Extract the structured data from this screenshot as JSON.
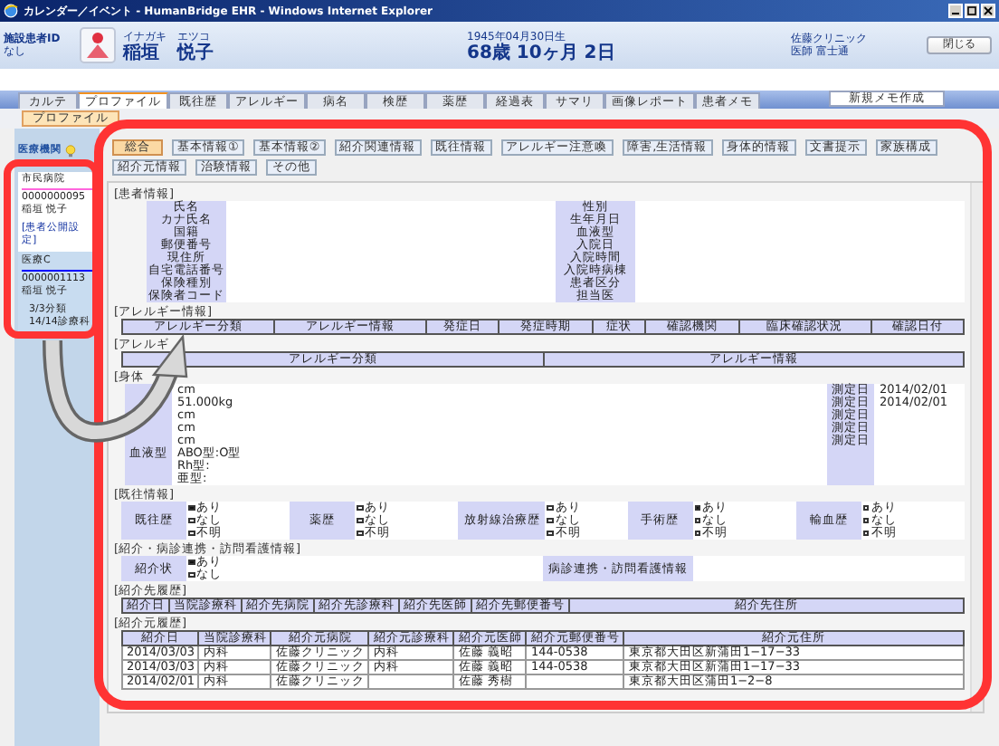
{
  "window": {
    "title": "カレンダー／イベント - HumanBridge EHR - Windows Internet Explorer"
  },
  "patient": {
    "id_label": "施設患者ID",
    "id_value": "なし",
    "kana": "イナガキ　エツコ",
    "name": "稲垣　悦子",
    "birth": "1945年04月30日生",
    "age": "68歳 10ヶ月 2日",
    "facility": "佐藤クリニック",
    "doctor": "医師 富士通",
    "close_button": "閉じる"
  },
  "tabs": [
    {
      "label": "カルテ",
      "selected": false
    },
    {
      "label": "プロファイル",
      "selected": true
    },
    {
      "label": "既往歴",
      "selected": false
    },
    {
      "label": "アレルギー",
      "selected": false
    },
    {
      "label": "病名",
      "selected": false
    },
    {
      "label": "検歴",
      "selected": false
    },
    {
      "label": "薬歴",
      "selected": false
    },
    {
      "label": "経過表",
      "selected": false
    },
    {
      "label": "サマリ",
      "selected": false
    },
    {
      "label": "画像レポート",
      "selected": false
    },
    {
      "label": "患者メモ",
      "selected": false
    }
  ],
  "new_memo_button": "新規メモ作成",
  "subtabs": [
    {
      "label": "プロファイル",
      "selected": true
    }
  ],
  "sidebar": {
    "title": "医療機関",
    "institutions": [
      {
        "name": "市民病院",
        "color": "#ff66dd",
        "id": "0000000095",
        "patient": "稲垣 悦子",
        "link": "[患者公開設定]"
      },
      {
        "name": "医療C",
        "color": "#0000ff",
        "id": "0000001113",
        "patient": "稲垣 悦子",
        "notes": [
          "3/3分類",
          "14/14診療科"
        ]
      }
    ]
  },
  "filters": [
    {
      "label": "総合",
      "selected": true
    },
    {
      "label": "基本情報①",
      "selected": false
    },
    {
      "label": "基本情報②",
      "selected": false
    },
    {
      "label": "紹介関連情報",
      "selected": false
    },
    {
      "label": "既往情報",
      "selected": false
    },
    {
      "label": "アレルギー注意喚",
      "selected": false
    },
    {
      "label": "障害,生活情報",
      "selected": false
    },
    {
      "label": "身体的情報",
      "selected": false
    },
    {
      "label": "文書提示",
      "selected": false
    },
    {
      "label": "家族構成",
      "selected": false
    },
    {
      "label": "紹介元情報",
      "selected": false
    },
    {
      "label": "治験情報",
      "selected": false
    },
    {
      "label": "その他",
      "selected": false
    }
  ],
  "sections": [
    {
      "kind": "fields",
      "title": "[患者情報]",
      "groups": [
        {
          "items": [
            {
              "label": "氏名"
            },
            {
              "label": "カナ氏名"
            },
            {
              "label": "国籍"
            },
            {
              "label": "郵便番号"
            },
            {
              "label": "現住所"
            },
            {
              "label": "自宅電話番号"
            },
            {
              "label": "保険種別"
            },
            {
              "label": "保険者コード"
            }
          ]
        },
        {
          "items": [
            {
              "label": "性別"
            },
            {
              "label": "生年月日"
            },
            {
              "label": "血液型"
            },
            {
              "label": "入院日"
            },
            {
              "label": "入院時間"
            },
            {
              "label": "入院時病棟"
            },
            {
              "label": "患者区分"
            },
            {
              "label": "担当医"
            }
          ]
        }
      ]
    },
    {
      "kind": "table",
      "title": "[アレルギー情報]",
      "columns": [
        "アレルギー分類",
        "アレルギー情報",
        "発症日",
        "発症時期",
        "症状",
        "確認機関",
        "臨床確認状況",
        "確認日付"
      ]
    },
    {
      "kind": "table",
      "title": "[アレルギ",
      "columns": [
        "アレルギー分類",
        "アレルギー情報"
      ]
    },
    {
      "kind": "measurements",
      "title": "[身体",
      "groups": [
        {
          "items": [
            {
              "value": "cm"
            },
            {
              "value": "51.000kg"
            },
            {
              "value": "cm"
            },
            {
              "value": "cm"
            },
            {
              "value": "cm"
            },
            {
              "label": "血液型",
              "value": "ABO型:O型"
            },
            {
              "value": "Rh型:"
            },
            {
              "value": "亜型:"
            }
          ]
        },
        {
          "items": [
            {
              "label": "測定日",
              "value": "2014/02/01"
            },
            {
              "label": "測定日",
              "value": "2014/02/01"
            },
            {
              "label": "測定日"
            },
            {
              "label": "測定日"
            },
            {
              "label": "測定日"
            }
          ]
        }
      ]
    },
    {
      "kind": "choices",
      "title": "[既往情報]",
      "items": [
        {
          "label": "既往歴",
          "options": [
            {
              "label": "あり",
              "selected": true
            },
            {
              "label": "なし",
              "selected": false
            },
            {
              "label": "不明",
              "selected": false
            }
          ]
        },
        {
          "label": "薬歴",
          "options": [
            {
              "label": "あり",
              "selected": false
            },
            {
              "label": "なし",
              "selected": false
            },
            {
              "label": "不明",
              "selected": false
            }
          ]
        },
        {
          "label": "放射線治療歴",
          "options": [
            {
              "label": "あり",
              "selected": false
            },
            {
              "label": "なし",
              "selected": false
            },
            {
              "label": "不明",
              "selected": false
            }
          ]
        },
        {
          "label": "手術歴",
          "options": [
            {
              "label": "あり",
              "selected": true
            },
            {
              "label": "なし",
              "selected": false
            },
            {
              "label": "不明",
              "selected": false
            }
          ]
        },
        {
          "label": "輸血歴",
          "options": [
            {
              "label": "あり",
              "selected": false
            },
            {
              "label": "なし",
              "selected": false
            },
            {
              "label": "不明",
              "selected": false
            }
          ]
        }
      ]
    },
    {
      "kind": "choices",
      "title": "[紹介・病診連携・訪問看護情報]",
      "items": [
        {
          "label": "紹介状",
          "options": [
            {
              "label": "あり",
              "selected": true
            },
            {
              "label": "なし",
              "selected": false
            }
          ]
        },
        {
          "label": "病診連携・訪問看護情報"
        }
      ]
    },
    {
      "kind": "history",
      "title": "[紹介先履歴]",
      "columns": [
        "紹介日",
        "当院診療科",
        "紹介先病院",
        "紹介先診療科",
        "紹介先医師",
        "紹介先郵便番号",
        "紹介先住所"
      ]
    },
    {
      "kind": "history",
      "title": "[紹介元履歴]",
      "columns": [
        "紹介日",
        "当院診療科",
        "紹介元病院",
        "紹介元診療科",
        "紹介元医師",
        "紹介元郵便番号",
        "紹介元住所"
      ],
      "rows": [
        [
          "2014/03/03",
          "内科",
          "佐藤クリニック",
          "内科",
          "佐藤 義昭",
          "144-0538",
          "東京都大田区新蒲田1−17−33"
        ],
        [
          "2014/03/03",
          "内科",
          "佐藤クリニック",
          "内科",
          "佐藤 義昭",
          "144-0538",
          "東京都大田区新蒲田1−17−33"
        ],
        [
          "2014/02/01",
          "内科",
          "佐藤クリニック",
          null,
          "佐藤 秀樹",
          null,
          "東京都大田区蒲田1−2−8"
        ]
      ]
    }
  ]
}
